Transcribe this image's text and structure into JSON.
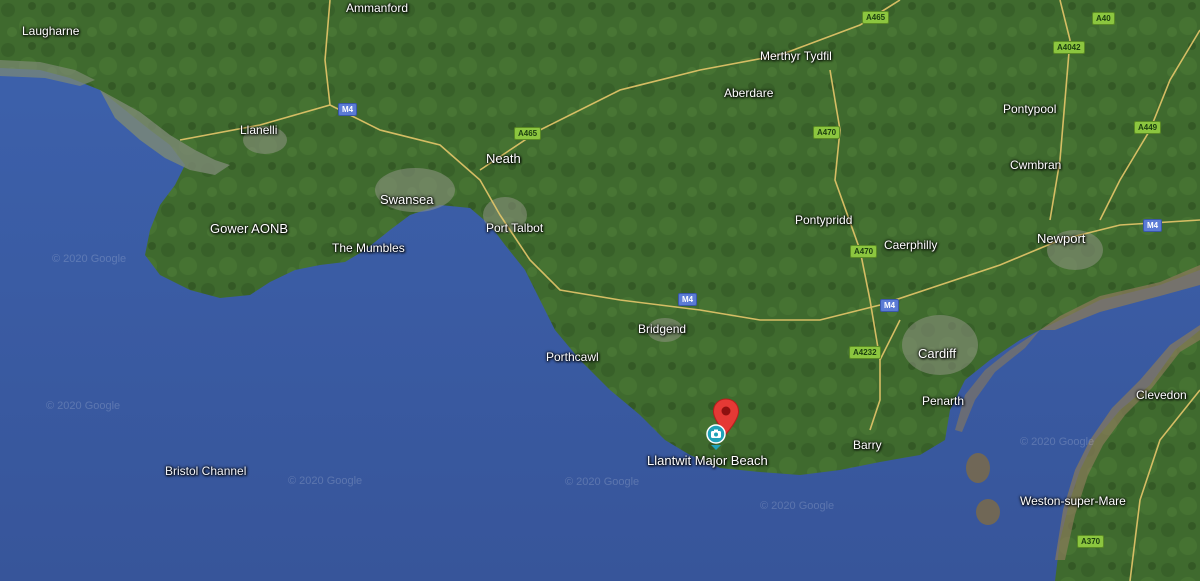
{
  "map": {
    "labels": {
      "laugharne": "Laugharne",
      "ammanford": "Ammanford",
      "llanelli": "Llanelli",
      "merthyr": "Merthyr Tydfil",
      "aberdare": "Aberdare",
      "pontypool": "Pontypool",
      "neath": "Neath",
      "swansea": "Swansea",
      "cwmbran": "Cwmbran",
      "gower": "Gower AONB",
      "port_talbot": "Port Talbot",
      "pontypridd": "Pontypridd",
      "caerphilly": "Caerphilly",
      "newport": "Newport",
      "mumbles": "The Mumbles",
      "bridgend": "Bridgend",
      "porthcawl": "Porthcawl",
      "cardiff": "Cardiff",
      "penarth": "Penarth",
      "clevedon": "Clevedon",
      "barry": "Barry",
      "llantwit": "Llantwit Major Beach",
      "bristol_channel": "Bristol Channel",
      "weston": "Weston-super-Mare"
    },
    "roads": {
      "a465_top": "A465",
      "a40": "A40",
      "a4042": "A4042",
      "m4_1": "M4",
      "a465": "A465",
      "a470_1": "A470",
      "a449": "A449",
      "m4_2": "M4",
      "a470_2": "A470",
      "m4_3": "M4",
      "m4_4": "M4",
      "a4232": "A4232",
      "a370": "A370"
    },
    "watermark": "© 2020 Google",
    "selected_place": "Llantwit Major Beach",
    "colors": {
      "sea": "#3b5a9e",
      "land": "#3f6a2e",
      "pin": "#e53935",
      "camera": "#1fa2b8"
    }
  }
}
